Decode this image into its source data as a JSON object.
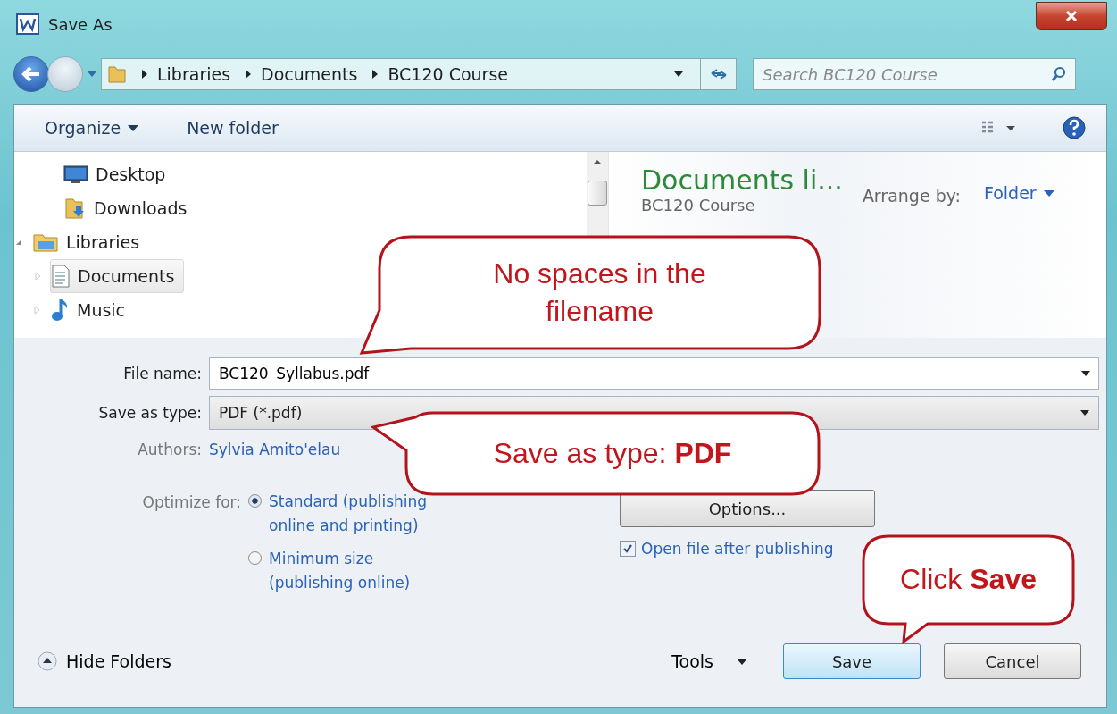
{
  "window": {
    "title": "Save As"
  },
  "address_bar": {
    "path": [
      "Libraries",
      "Documents",
      "BC120 Course"
    ]
  },
  "search": {
    "placeholder": "Search BC120 Course"
  },
  "toolbar": {
    "organize": "Organize",
    "new_folder": "New folder"
  },
  "nav_tree": [
    {
      "label": "Desktop",
      "kind": "desktop",
      "selected": false
    },
    {
      "label": "Downloads",
      "kind": "downloads",
      "selected": false
    },
    {
      "label": "Libraries",
      "kind": "library",
      "selected": false,
      "expanded": true,
      "children": [
        {
          "label": "Documents",
          "kind": "document",
          "selected": true,
          "expanded": false
        },
        {
          "label": "Music",
          "kind": "music",
          "selected": false,
          "expanded": false
        }
      ]
    }
  ],
  "library_header": {
    "title": "Documents li...",
    "subtitle": "BC120 Course",
    "arrange_label": "Arrange by:",
    "arrange_value": "Folder"
  },
  "file_name": {
    "label": "File name:",
    "value": "BC120_Syllabus.pdf"
  },
  "save_as_type": {
    "label": "Save as type:",
    "value": "PDF (*.pdf)"
  },
  "authors": {
    "label": "Authors:",
    "value": "Sylvia Amito'elau"
  },
  "optimize": {
    "label": "Optimize for:",
    "options": [
      {
        "lines": [
          "Standard (publishing",
          "online and printing)"
        ],
        "selected": true
      },
      {
        "lines": [
          "Minimum size",
          "(publishing online)"
        ],
        "selected": false
      }
    ]
  },
  "options_button": "Options...",
  "open_after": {
    "label": "Open file after publishing",
    "checked": true
  },
  "hide_folders": "Hide Folders",
  "tools": "Tools",
  "buttons": [
    {
      "label": "Save",
      "kind": "default"
    },
    {
      "label": "Cancel",
      "kind": "normal"
    }
  ],
  "callouts": [
    {
      "text": "No spaces in the filename"
    },
    {
      "text": "Save as type: **PDF**"
    },
    {
      "text": "Click **Save**"
    }
  ]
}
